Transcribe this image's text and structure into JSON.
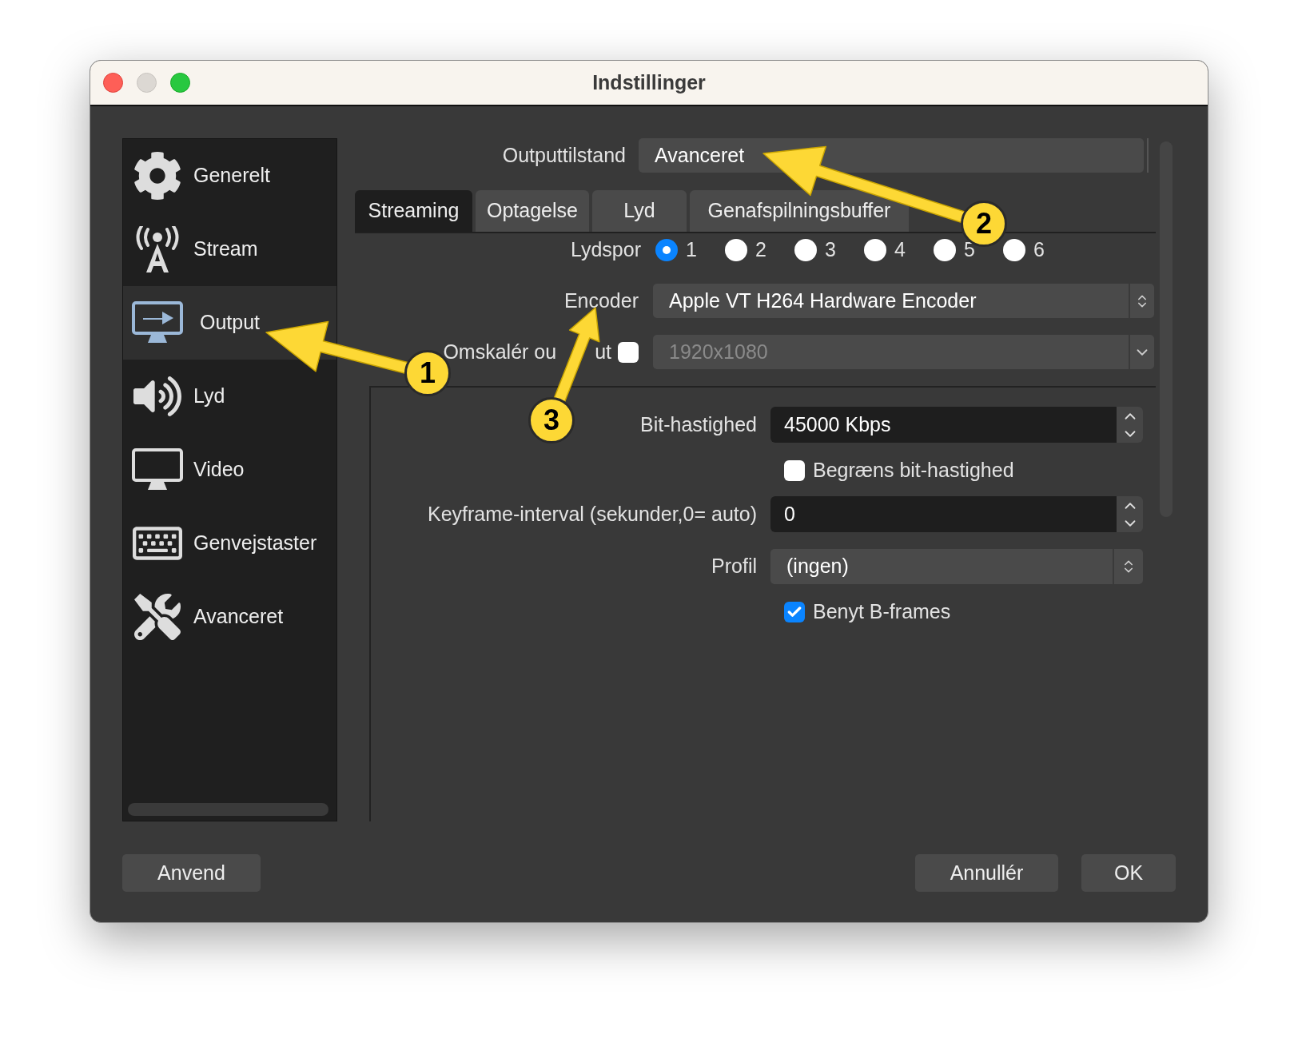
{
  "window": {
    "title": "Indstillinger"
  },
  "sidebar": {
    "items": [
      {
        "label": "Generelt",
        "selected": false
      },
      {
        "label": "Stream",
        "selected": false
      },
      {
        "label": "Output",
        "selected": true
      },
      {
        "label": "Lyd",
        "selected": false
      },
      {
        "label": "Video",
        "selected": false
      },
      {
        "label": "Genvejstaster",
        "selected": false
      },
      {
        "label": "Avanceret",
        "selected": false
      }
    ]
  },
  "output_mode": {
    "label": "Outputtilstand",
    "value": "Avanceret"
  },
  "tabs": [
    {
      "label": "Streaming",
      "selected": true
    },
    {
      "label": "Optagelse",
      "selected": false
    },
    {
      "label": "Lyd",
      "selected": false
    },
    {
      "label": "Genafspilningsbuffer",
      "selected": false
    }
  ],
  "audio_track": {
    "label": "Lydspor",
    "options": [
      {
        "label": "1",
        "selected": true
      },
      {
        "label": "2",
        "selected": false
      },
      {
        "label": "3",
        "selected": false
      },
      {
        "label": "4",
        "selected": false
      },
      {
        "label": "5",
        "selected": false
      },
      {
        "label": "6",
        "selected": false
      }
    ]
  },
  "encoder": {
    "label": "Encoder",
    "value": "Apple VT H264 Hardware Encoder"
  },
  "rescale": {
    "label": "Omskalér ou",
    "label_tail": "ut",
    "checked": false,
    "value": "1920x1080",
    "disabled": true
  },
  "encoder_settings": {
    "bitrate": {
      "label": "Bit-hastighed",
      "value": "45000 Kbps"
    },
    "limit_bitrate": {
      "label": "Begræns bit-hastighed",
      "checked": false
    },
    "keyframe": {
      "label": "Keyframe-interval (sekunder,0= auto)",
      "value": "0"
    },
    "profile": {
      "label": "Profil",
      "value": "(ingen)"
    },
    "bframes": {
      "label": "Benyt B-frames",
      "checked": true
    }
  },
  "buttons": [
    {
      "label": "Anvend"
    },
    {
      "label": "Annullér"
    },
    {
      "label": "OK"
    }
  ],
  "annotations": [
    {
      "label": "1"
    },
    {
      "label": "2"
    },
    {
      "label": "3"
    }
  ]
}
